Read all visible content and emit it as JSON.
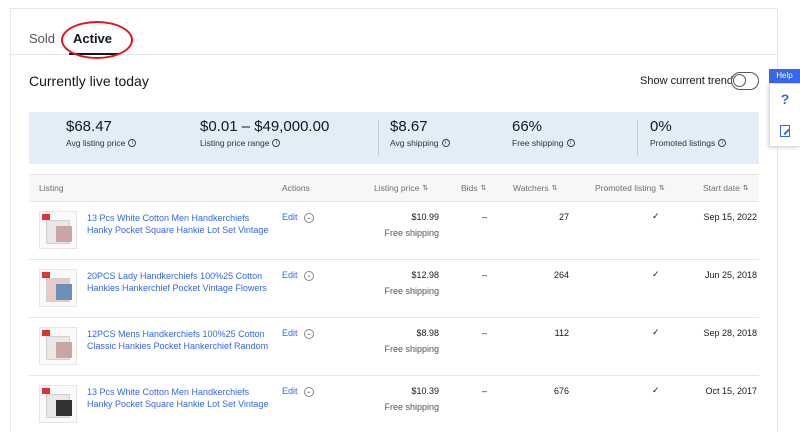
{
  "tabs": {
    "sold": "Sold",
    "active": "Active"
  },
  "header": {
    "title": "Currently live today",
    "trends_label": "Show current trends"
  },
  "stats": [
    {
      "value": "$68.47",
      "label": "Avg listing price"
    },
    {
      "value": "$0.01 – $49,000.00",
      "label": "Listing price range"
    },
    {
      "value": "$8.67",
      "label": "Avg shipping"
    },
    {
      "value": "66%",
      "label": "Free shipping"
    },
    {
      "value": "0%",
      "label": "Promoted listings"
    }
  ],
  "columns": {
    "listing": "Listing",
    "actions": "Actions",
    "listing_price": "Listing price",
    "bids": "Bids",
    "watchers": "Watchers",
    "promoted_listing": "Promoted listing",
    "start_date": "Start date"
  },
  "rows": [
    {
      "title": "13 Pcs White Cotton Men Handkerchiefs Hanky Pocket Square Hankie Lot Set Vintage",
      "action": "Edit",
      "price": "$10.99",
      "shipping": "Free shipping",
      "bids": "–",
      "watchers": "27",
      "promoted": "✓",
      "start_date": "Sep 15, 2022"
    },
    {
      "title": "20PCS Lady Handkerchiefs 100%25 Cotton Hankies Hankerchief Pocket Vintage Flowers",
      "action": "Edit",
      "price": "$12.98",
      "shipping": "Free shipping",
      "bids": "–",
      "watchers": "264",
      "promoted": "✓",
      "start_date": "Jun 25, 2018"
    },
    {
      "title": "12PCS Mens Handkerchiefs 100%25 Cotton Classic Hankies Pocket Hankerchief Random",
      "action": "Edit",
      "price": "$8.98",
      "shipping": "Free shipping",
      "bids": "–",
      "watchers": "112",
      "promoted": "✓",
      "start_date": "Sep 28, 2018"
    },
    {
      "title": "13 Pcs White Cotton Men Handkerchiefs Hanky Pocket Square Hankie Lot Set Vintage",
      "action": "Edit",
      "price": "$10.39",
      "shipping": "Free shipping",
      "bids": "–",
      "watchers": "676",
      "promoted": "✓",
      "start_date": "Oct 15, 2017"
    }
  ],
  "help": {
    "label": "Help",
    "question": "?"
  },
  "colors": {
    "accent": "#3665f3",
    "stats_bg": "#e2edf8",
    "highlight_circle": "#e0141e"
  },
  "icons": {
    "info": "info-icon",
    "sort": "sort-icon",
    "chevron": "chevron-down-icon",
    "help": "question-icon",
    "feedback": "edit-icon"
  }
}
